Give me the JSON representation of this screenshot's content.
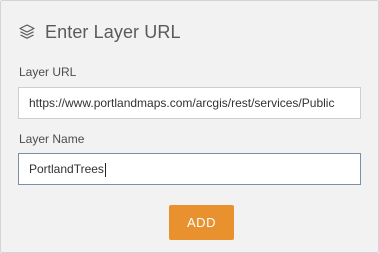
{
  "header": {
    "title": "Enter Layer URL",
    "icon": "layers-icon"
  },
  "form": {
    "url_label": "Layer URL",
    "url_value": "https://www.portlandmaps.com/arcgis/rest/services/Public",
    "name_label": "Layer Name",
    "name_value": "PortlandTrees"
  },
  "actions": {
    "add_label": "ADD"
  },
  "colors": {
    "panel_bg": "#f2f2f2",
    "accent": "#e8912e",
    "focus_border": "#7a8fa8"
  }
}
